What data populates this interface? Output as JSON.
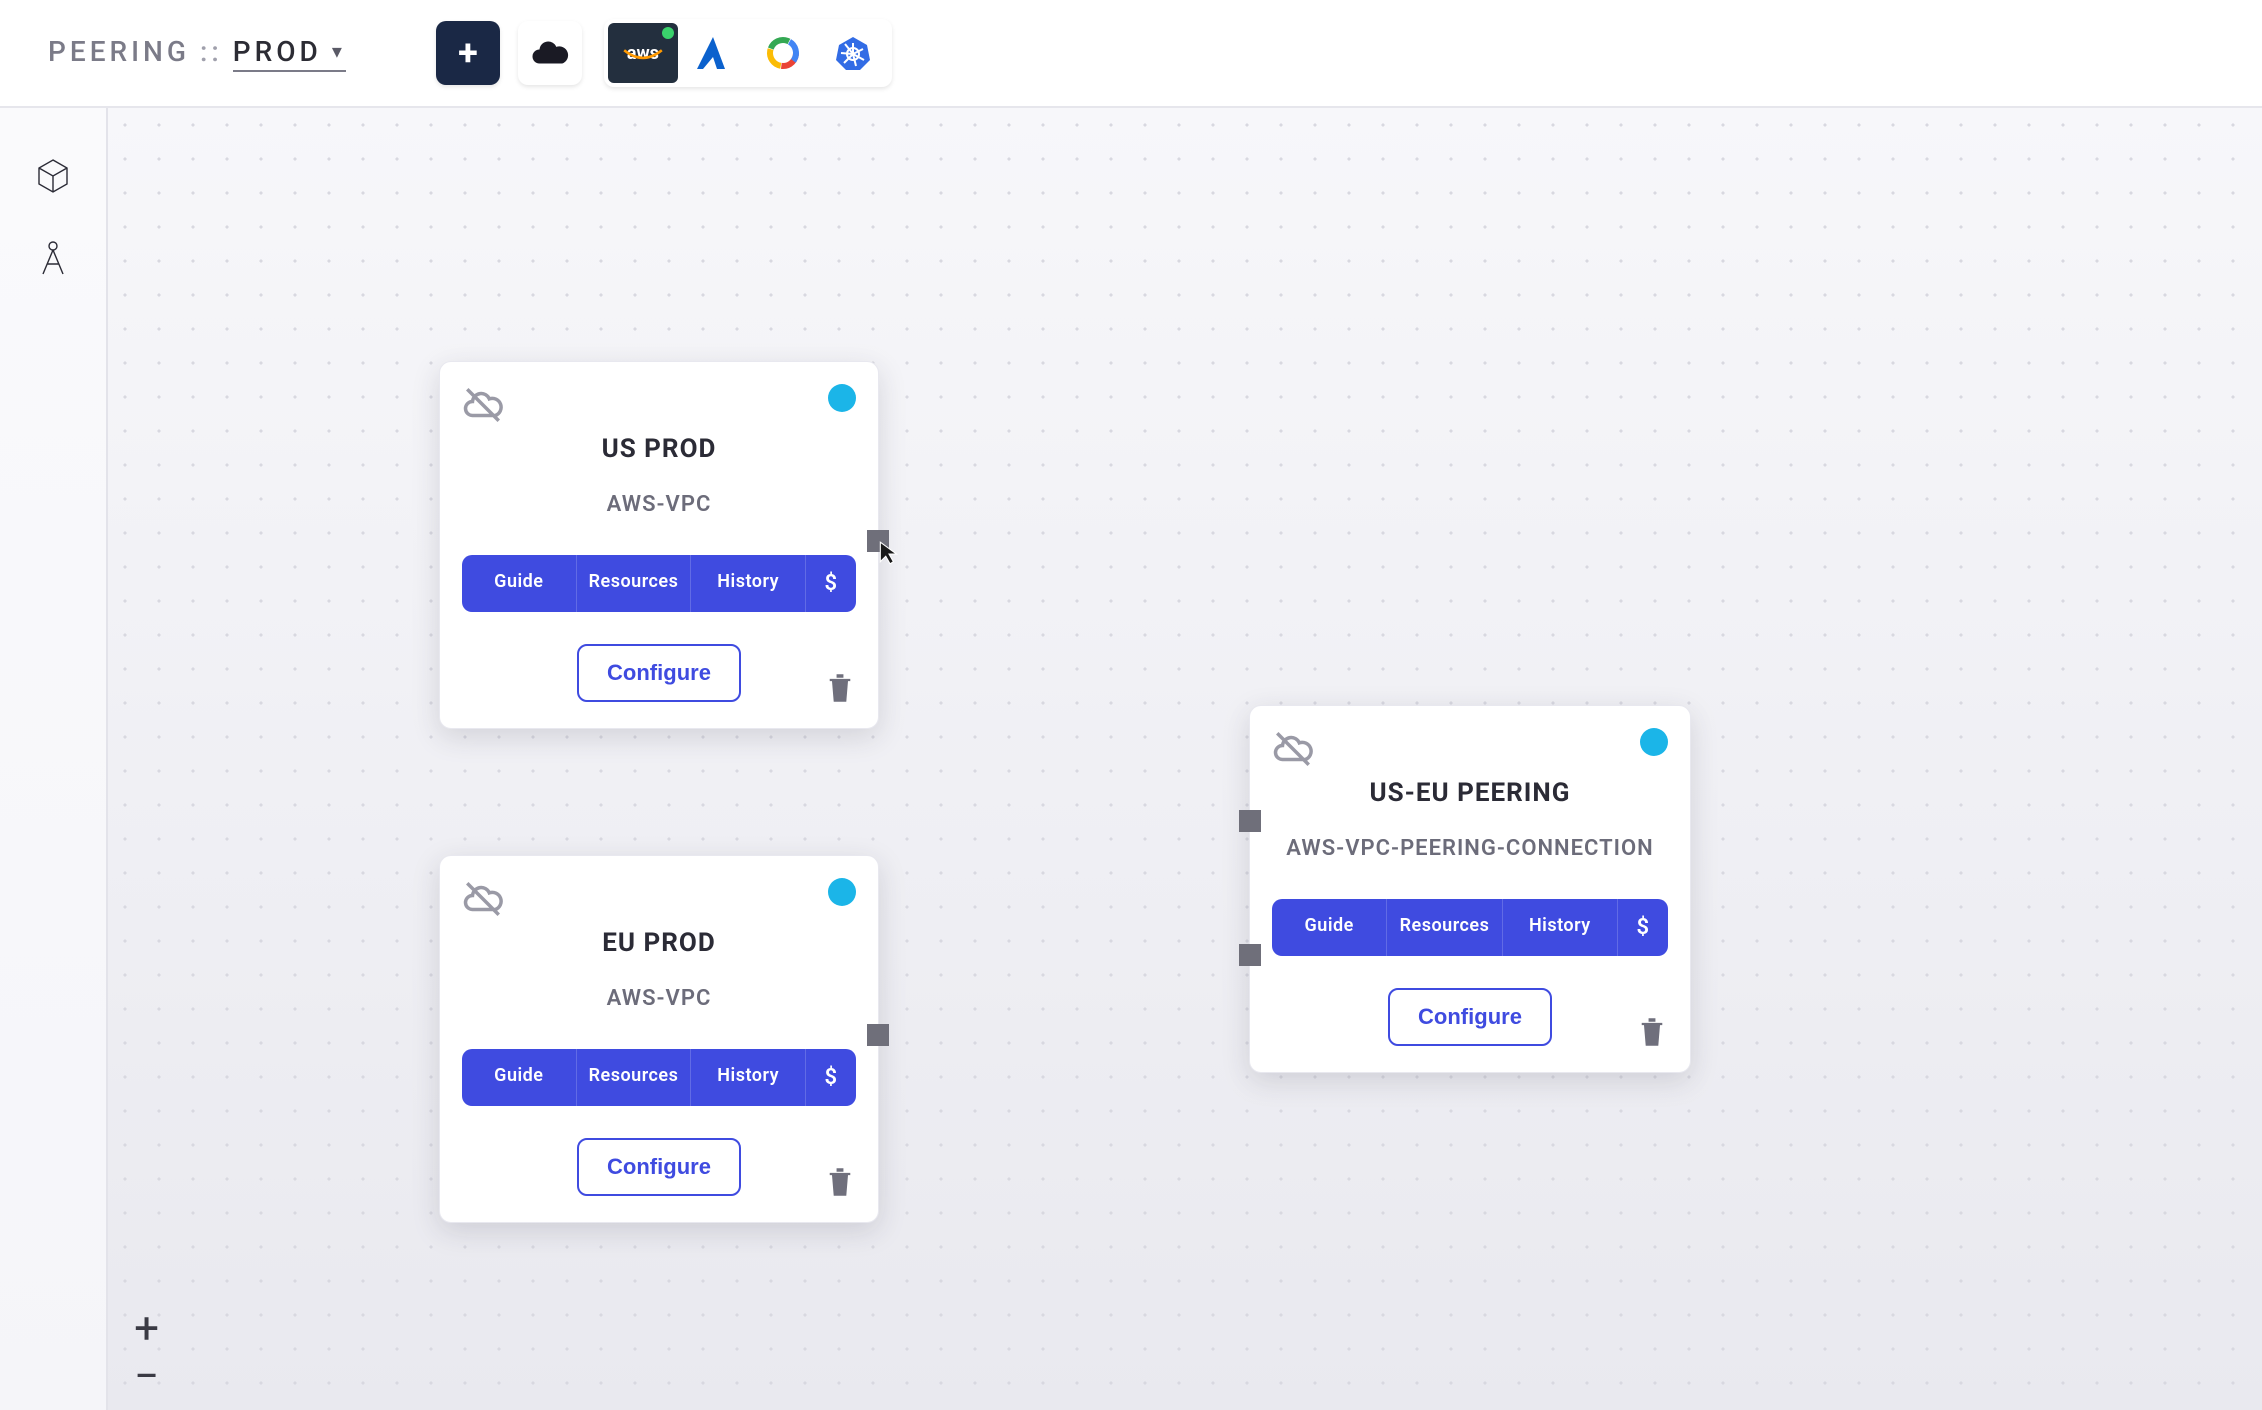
{
  "breadcrumb": {
    "section": "PEERING",
    "sep": "::",
    "env": "PROD"
  },
  "toolbar": {
    "add_label": "+",
    "providers": {
      "aws": "aws",
      "azure": "azure",
      "gcp": "gcp",
      "k8s": "k8s"
    }
  },
  "nodes": {
    "us_prod": {
      "title": "US PROD",
      "subtitle": "AWS-VPC",
      "pills": {
        "guide": "Guide",
        "resources": "Resources",
        "history": "History",
        "cost": "$"
      },
      "configure": "Configure",
      "status_color": "#1bb5e8"
    },
    "eu_prod": {
      "title": "EU PROD",
      "subtitle": "AWS-VPC",
      "pills": {
        "guide": "Guide",
        "resources": "Resources",
        "history": "History",
        "cost": "$"
      },
      "configure": "Configure",
      "status_color": "#1bb5e8"
    },
    "peering": {
      "title": "US-EU PEERING",
      "subtitle": "AWS-VPC-PEERING-CONNECTION",
      "pills": {
        "guide": "Guide",
        "resources": "Resources",
        "history": "History",
        "cost": "$"
      },
      "configure": "Configure",
      "status_color": "#1bb5e8"
    }
  },
  "zoom": {
    "in": "+",
    "out": "−"
  }
}
